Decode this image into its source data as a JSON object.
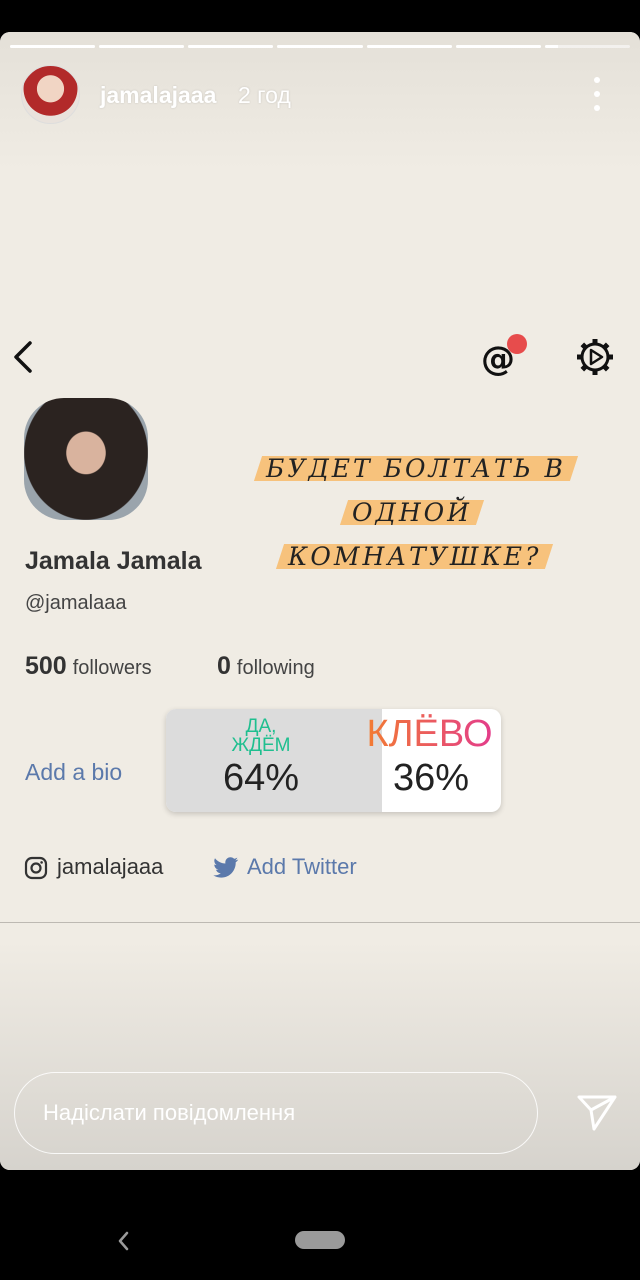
{
  "story": {
    "progress_segments": [
      1,
      1,
      1,
      1,
      1,
      1,
      0.15
    ],
    "username": "jamalajaaa",
    "time_ago": "2 год"
  },
  "profile": {
    "display_name": "Jamala Jamala",
    "handle": "@jamalaaa",
    "followers_count": "500",
    "followers_label": "followers",
    "following_count": "0",
    "following_label": "following",
    "bio_link": "Add a bio",
    "instagram": "jamalajaaa",
    "twitter_link": "Add Twitter"
  },
  "sticker_text": [
    "БУДЕТ БОЛТАТЬ В",
    "ОДНОЙ",
    "КОМНАТУШКЕ?"
  ],
  "poll": {
    "option1_label": "ДА, ЖДЁМ",
    "option1_percent": "64%",
    "option2_label": "КЛЁВО",
    "option2_percent": "36%"
  },
  "reply": {
    "placeholder": "Надіслати повідомлення"
  },
  "icons": [
    "back-icon",
    "mention-icon",
    "settings-gear-icon",
    "more-icon",
    "instagram-icon",
    "twitter-icon",
    "send-icon"
  ],
  "colors": {
    "background": "#f0ece4",
    "link": "#5b79ab",
    "sticker_highlight": "#f7c27c",
    "badge": "#e74c4c",
    "poll_option1": "#1fbf8f",
    "poll_option2_start": "#f37e2e",
    "poll_option2_end": "#e33a8e"
  }
}
